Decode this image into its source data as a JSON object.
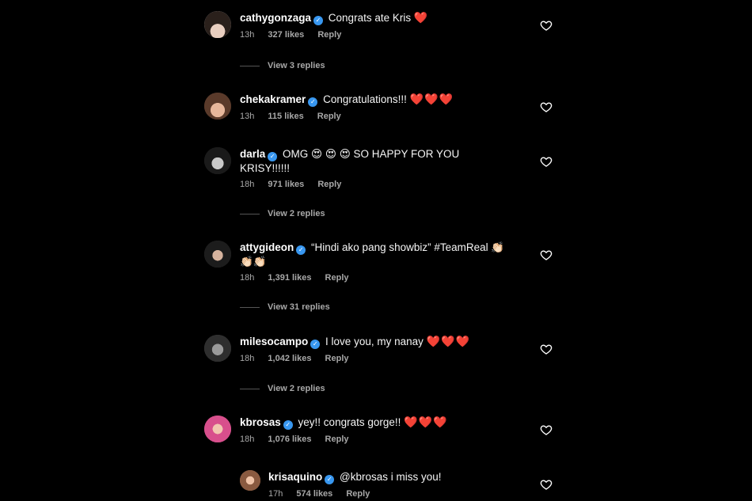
{
  "comments": [
    {
      "username": "cathygonzaga",
      "text": "Congrats ate Kris",
      "emoji": "❤️",
      "time": "13h",
      "likes": "327 likes",
      "reply": "Reply",
      "view_replies": "View 3 replies"
    },
    {
      "username": "chekakramer",
      "text": "Congratulations!!!",
      "emoji": "❤️❤️❤️",
      "time": "13h",
      "likes": "115 likes",
      "reply": "Reply"
    },
    {
      "username": "darla",
      "text": "OMG 😍 😍 😍 SO HAPPY FOR YOU KRISY!!!!!!",
      "emoji": "",
      "time": "18h",
      "likes": "971 likes",
      "reply": "Reply",
      "view_replies": "View 2 replies"
    },
    {
      "username": "attygideon",
      "text": "“Hindi ako pang showbiz” #TeamReal 👏🏻👏🏻👏🏻",
      "emoji": "",
      "time": "18h",
      "likes": "1,391 likes",
      "reply": "Reply",
      "view_replies": "View 31 replies"
    },
    {
      "username": "milesocampo",
      "text": "I love you, my nanay",
      "emoji": "❤️❤️❤️",
      "time": "18h",
      "likes": "1,042 likes",
      "reply": "Reply",
      "view_replies": "View 2 replies"
    },
    {
      "username": "kbrosas",
      "text": "yey!! congrats gorge!!",
      "emoji": "❤️❤️❤️",
      "time": "18h",
      "likes": "1,076 likes",
      "reply": "Reply"
    },
    {
      "username": "krisaquino",
      "text": "@kbrosas i miss you!",
      "emoji": "",
      "time": "17h",
      "likes": "574 likes",
      "reply": "Reply"
    }
  ],
  "icons": {
    "verified": "verified-badge-icon",
    "like": "heart-outline-icon"
  },
  "colors": {
    "background": "#000000",
    "verified": "#3897f0",
    "meta": "#a8a8a8",
    "heart": "#e0245e"
  }
}
